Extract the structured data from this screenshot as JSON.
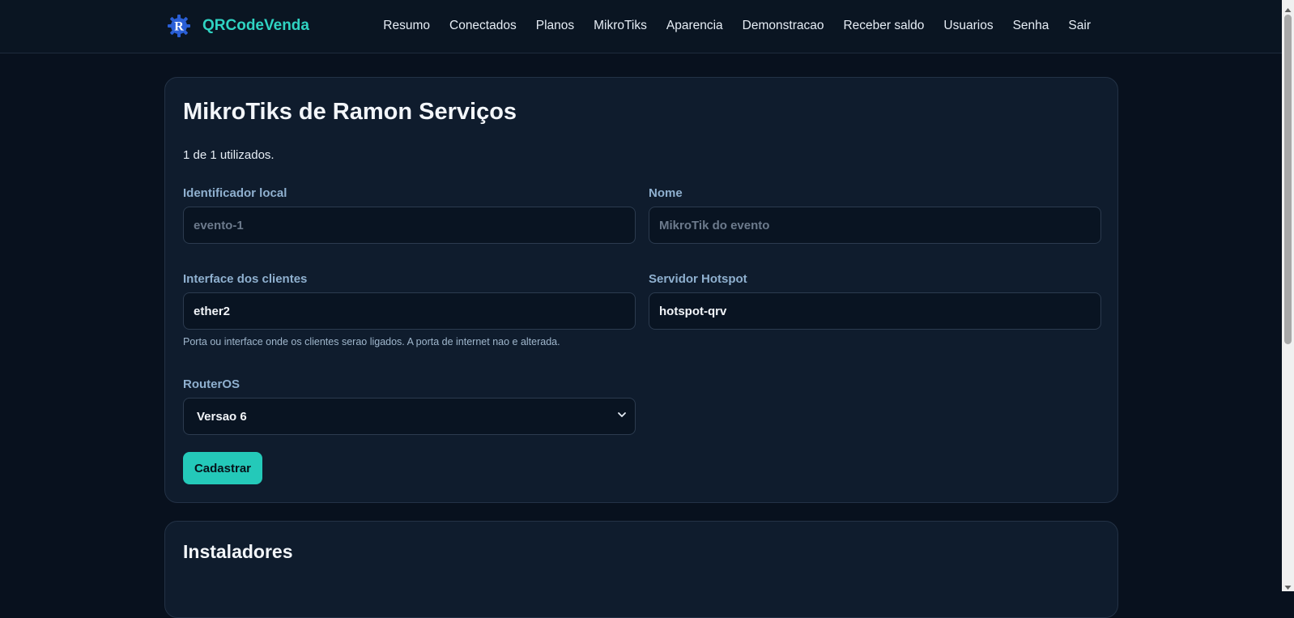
{
  "app": {
    "brand": "QRCodeVenda",
    "logo_letter": "R"
  },
  "nav": {
    "items": [
      "Resumo",
      "Conectados",
      "Planos",
      "MikroTiks",
      "Aparencia",
      "Demonstracao",
      "Receber saldo",
      "Usuarios",
      "Senha",
      "Sair"
    ]
  },
  "main": {
    "title": "MikroTiks de Ramon Serviços",
    "usage": "1 de 1 utilizados.",
    "form": {
      "local_id": {
        "label": "Identificador local",
        "placeholder": "evento-1",
        "value": ""
      },
      "name": {
        "label": "Nome",
        "placeholder": "MikroTik do evento",
        "value": ""
      },
      "interface": {
        "label": "Interface dos clientes",
        "value": "ether2",
        "hint": "Porta ou interface onde os clientes serao ligados. A porta de internet nao e alterada."
      },
      "hotspot": {
        "label": "Servidor Hotspot",
        "value": "hotspot-qrv"
      },
      "routeros": {
        "label": "RouterOS",
        "selected": "Versao 6"
      },
      "submit_label": "Cadastrar"
    }
  },
  "installers": {
    "title": "Instaladores"
  },
  "colors": {
    "accent": "#24c9b9",
    "brand_text": "#2fd3c2",
    "background": "#08111e",
    "card": "#0f1c2d"
  },
  "icons": {
    "logo": "gear-logo-icon",
    "select_arrow": "chevron-down-icon"
  }
}
